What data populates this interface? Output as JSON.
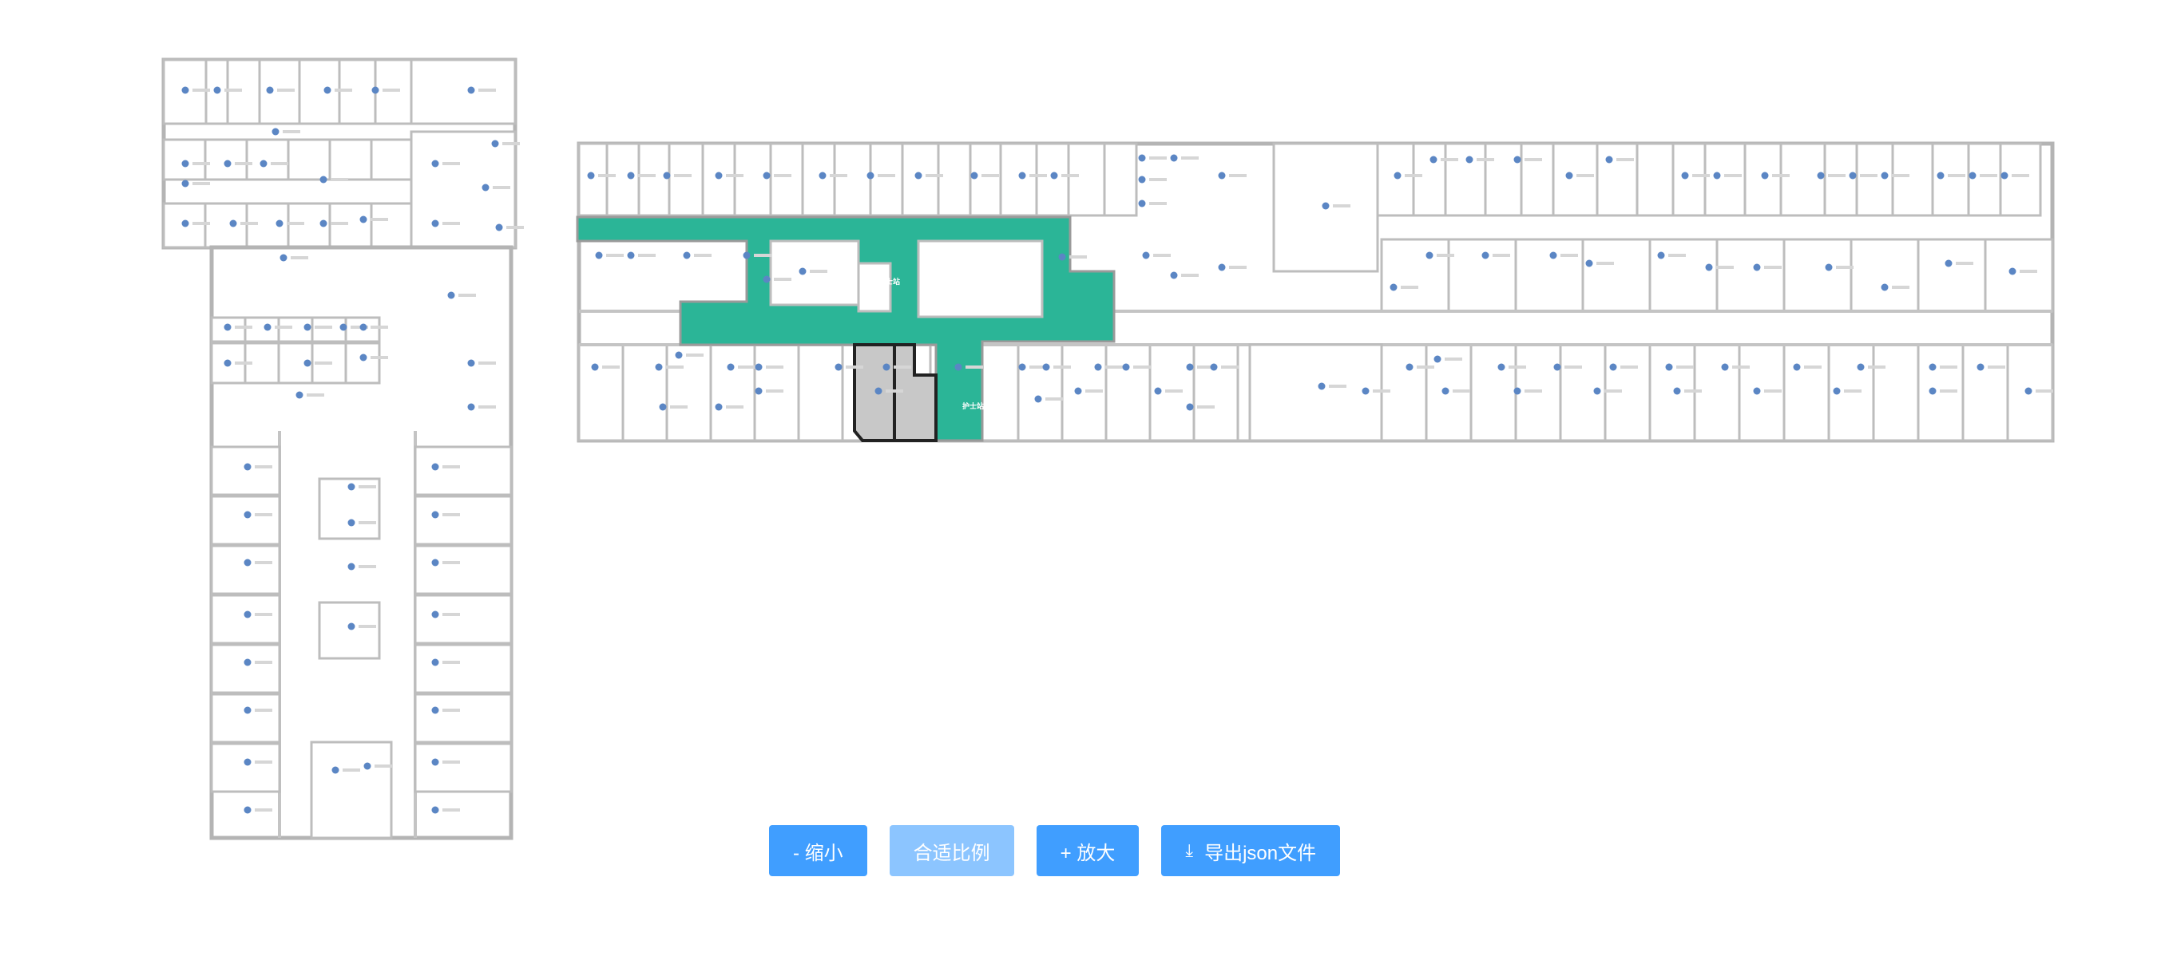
{
  "toolbar": {
    "zoom_out_label": "- 缩小",
    "fit_label": "合适比例",
    "zoom_in_label": "+ 放大",
    "export_label": "导出json文件",
    "export_icon": "download-icon"
  },
  "plan": {
    "highlight_color": "#2bb597",
    "selected_color": "#c8c8c8",
    "accent_color": "#409eff"
  }
}
